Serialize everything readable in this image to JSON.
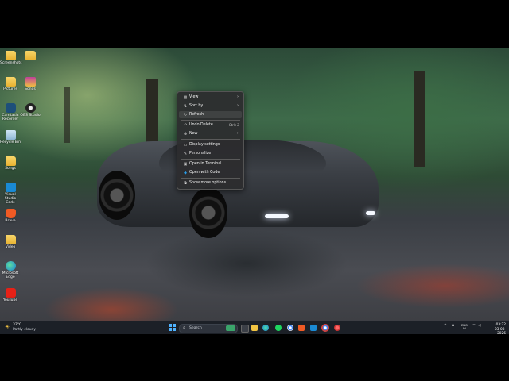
{
  "desktop": {
    "icons": [
      {
        "label": "Screenshots",
        "icon": "folder-icon"
      },
      {
        "label": "",
        "icon": "folder-icon"
      },
      {
        "label": "Pictures",
        "icon": "folder-icon"
      },
      {
        "label": "Songs",
        "icon": "folder-image-icon"
      },
      {
        "label": "Camtasia Recorder",
        "icon": "camtasia-icon"
      },
      {
        "label": "OBS Studio",
        "icon": "obs-icon"
      },
      {
        "label": "Recycle Bin",
        "icon": "recycle-bin-icon"
      },
      {
        "label": "Songs",
        "icon": "folder-icon"
      },
      {
        "label": "Visual Studio Code",
        "icon": "vscode-icon"
      },
      {
        "label": "Brave",
        "icon": "brave-icon"
      },
      {
        "label": "Video",
        "icon": "folder-icon"
      },
      {
        "label": "Microsoft Edge",
        "icon": "edge-icon"
      },
      {
        "label": "YouTube",
        "icon": "youtube-icon"
      }
    ]
  },
  "context_menu": {
    "items": [
      {
        "label": "View",
        "icon": "grid-icon",
        "has_submenu": true
      },
      {
        "label": "Sort by",
        "icon": "sort-icon",
        "has_submenu": true
      },
      {
        "label": "Refresh",
        "icon": "refresh-icon",
        "hover": true
      },
      {
        "label": "Undo Delete",
        "icon": "undo-icon",
        "shortcut": "Ctrl+Z"
      },
      {
        "label": "New",
        "icon": "plus-circle-icon",
        "has_submenu": true
      },
      {
        "label": "Display settings",
        "icon": "display-icon"
      },
      {
        "label": "Personalize",
        "icon": "brush-icon"
      },
      {
        "label": "Open in Terminal",
        "icon": "terminal-icon"
      },
      {
        "label": "Open with Code",
        "icon": "vscode-icon"
      },
      {
        "label": "Show more options",
        "icon": "more-options-icon"
      }
    ]
  },
  "taskbar": {
    "weather": {
      "temp": "33°C",
      "condition": "Partly cloudy"
    },
    "search_placeholder": "Search",
    "pinned_apps": [
      "file-explorer-icon",
      "folder-icon",
      "edge-icon",
      "spotify-icon",
      "chrome-icon",
      "brave-icon",
      "vscode-icon",
      "chrome-alt-icon",
      "settings-icon"
    ],
    "tray": {
      "language": "ENG",
      "region": "IN"
    },
    "clock": {
      "time": "03:22",
      "date": "03-08-2026"
    }
  },
  "colors": {
    "accent": "#4fb3ff",
    "taskbar_bg": "#1c2027",
    "menu_bg": "#2c2c2e",
    "folder": "#e8b230"
  }
}
